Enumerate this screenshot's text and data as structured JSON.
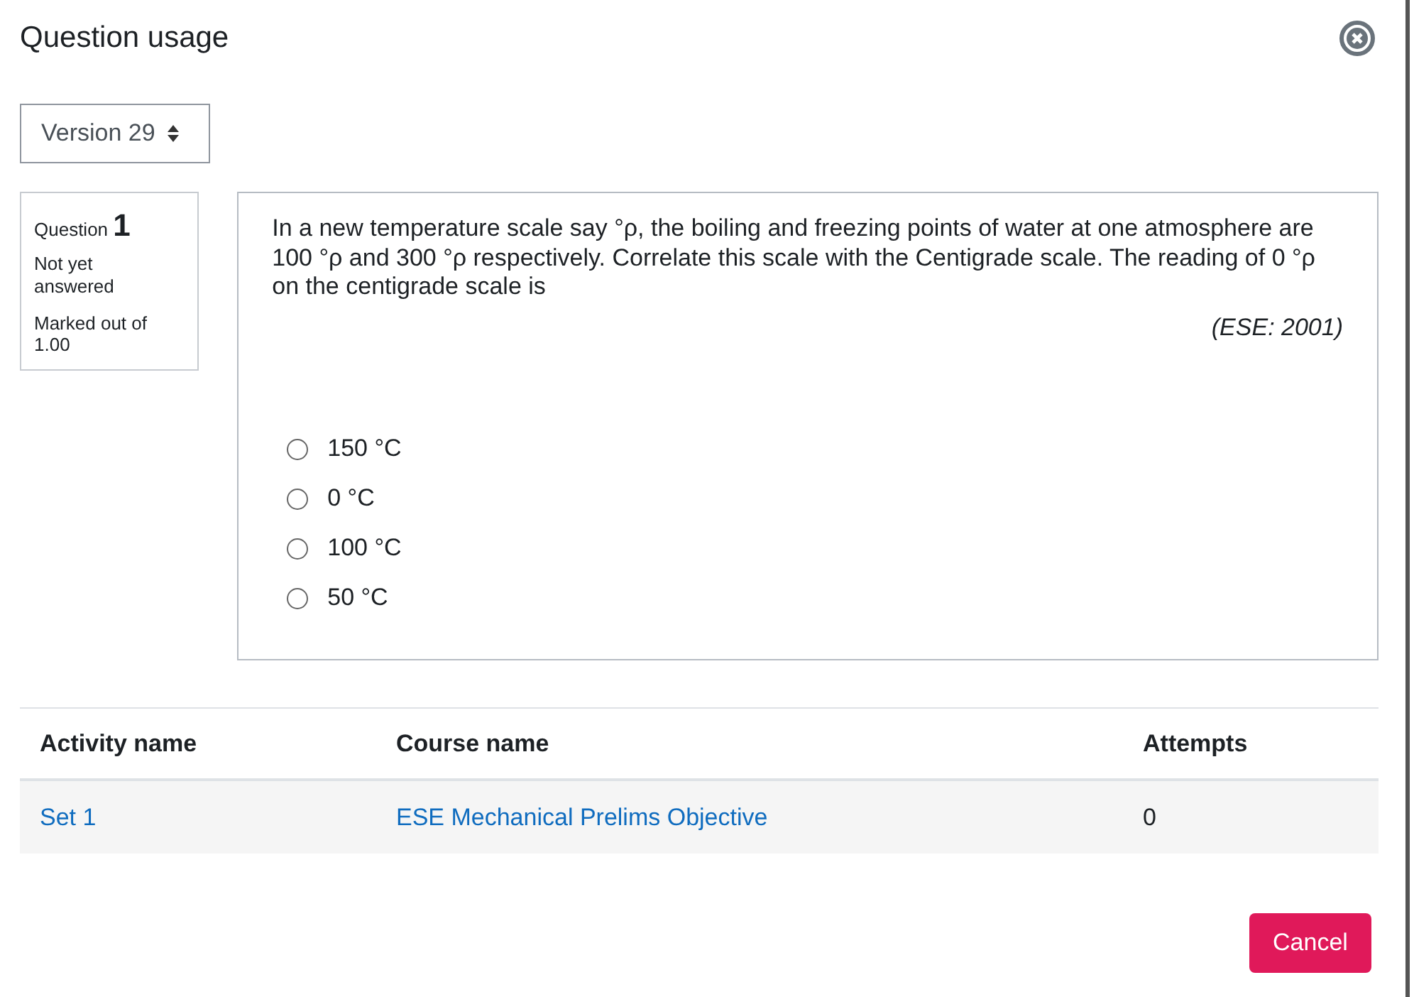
{
  "dialog": {
    "title": "Question usage"
  },
  "version_select": {
    "value": "Version 29"
  },
  "question_info": {
    "label": "Question",
    "number": "1",
    "state": "Not yet answered",
    "marks": "Marked out of 1.00"
  },
  "question": {
    "text": "In a new temperature scale say °ρ, the boiling and freezing points of water at one atmosphere are 100 °ρ and 300 °ρ respectively. Correlate this scale with the Centigrade scale. The reading of 0 °ρ on the centigrade scale is",
    "source": "(ESE: 2001)",
    "options": [
      {
        "label": "150 °C",
        "selected": false
      },
      {
        "label": "0 °C",
        "selected": false
      },
      {
        "label": "100 °C",
        "selected": false
      },
      {
        "label": "50 °C",
        "selected": false
      }
    ]
  },
  "table": {
    "columns": [
      "Activity name",
      "Course name",
      "Attempts"
    ],
    "rows": [
      [
        "Set 1",
        "ESE Mechanical Prelims Objective",
        "0"
      ]
    ]
  },
  "buttons": [
    "Cancel"
  ]
}
